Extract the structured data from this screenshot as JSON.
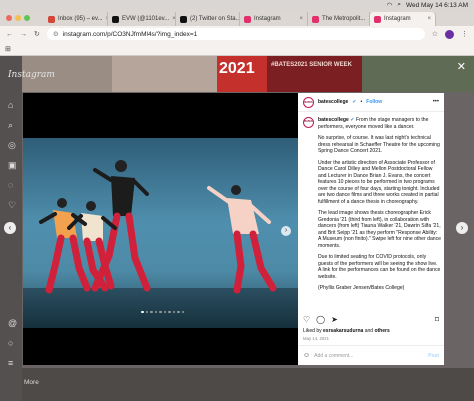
{
  "menubar": {
    "clock": "Wed May 14  6:13 AM"
  },
  "tabs": [
    {
      "label": "Inbox (95) – ev...",
      "color": "#d44638",
      "active": false
    },
    {
      "label": "EVW (@1101ev...",
      "color": "#111111",
      "active": false
    },
    {
      "label": "(2) Twitter on Sta...",
      "color": "#111111",
      "active": false
    },
    {
      "label": "Instagram",
      "color": "#e1306c",
      "active": false
    },
    {
      "label": "The Metropolit...",
      "color": "#e1306c",
      "active": false
    },
    {
      "label": "Instagram",
      "color": "#e1306c",
      "active": true
    }
  ],
  "address": {
    "url": "instagram.com/p/CO3NJfmMl4s/?img_index=1"
  },
  "sidebar": {
    "logo": "Instagram",
    "more_label": "More"
  },
  "background": {
    "sign_text": "2021",
    "banner_text": "#BATES2021 SENIOR WEEK"
  },
  "post": {
    "username": "batescollege",
    "follow_label": "Follow",
    "avatar_text": "BATES",
    "caption_lead": "From the stage managers to the performers, everyone moved like a dancer.",
    "paragraphs": [
      "No surprise, of course. It was last night's technical dress rehearsal in Schaeffer Theatre for the upcoming Spring Dance Concert 2021.",
      "Under the artistic direction of Associate Professor of Dance Carol Dilley and Mellon Postdoctoral Fellow and Lecturer in Dance Brian J. Evans, the concert features 10 pieces to be performed in two programs over the course of four days, starting tonight. Included are two dance films and three works created in partial fulfillment of a dance thesis in choreography.",
      "The lead image shows thesis choreographer Erick Gredonia '21 (third from left), in collaboration with dancers (from left) Tiauna Walker '21, Dawrin Silfa '21, and Brit Seipp '21 as they perform \"Response Ability: A Museum (non finito).\" Swipe left for nine other dance moments.",
      "Due to limited seating for COVID protocols, only guests of the performers will be seeing the show live. A link for the performances can be found on the dance website.",
      "(Phyllis Graber Jensen/Bates College)"
    ],
    "likes_prefix": "Liked by",
    "liked_by_user": "esrsakarsudurna",
    "likes_suffix": "and",
    "likes_others": "others",
    "date": "May 14, 2021",
    "comment_placeholder": "Add a comment...",
    "post_label": "Post",
    "carousel": {
      "count": 10,
      "current": 1
    }
  }
}
